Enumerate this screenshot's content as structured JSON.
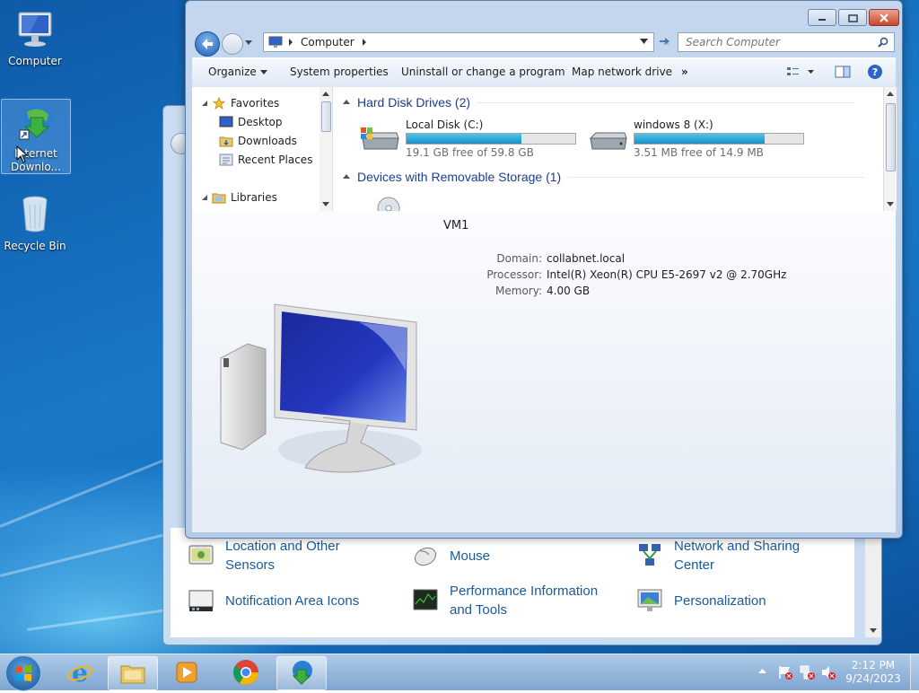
{
  "desktop": {
    "icons": [
      {
        "label": "Computer"
      },
      {
        "label_line1": "Internet",
        "label_line2": "Downlo..."
      },
      {
        "label": "Recycle Bin"
      }
    ]
  },
  "explorer": {
    "address": {
      "segment": "Computer"
    },
    "search": {
      "placeholder": "Search Computer"
    },
    "toolbar": {
      "organize": "Organize",
      "system_properties": "System properties",
      "uninstall": "Uninstall or change a program",
      "map_drive": "Map network drive",
      "more": "»"
    },
    "nav": {
      "favorites": "Favorites",
      "desktop": "Desktop",
      "downloads": "Downloads",
      "recent": "Recent Places",
      "libraries": "Libraries"
    },
    "groups": {
      "hdd": "Hard Disk Drives (2)",
      "removable": "Devices with Removable Storage (1)"
    },
    "drives": [
      {
        "name": "Local Disk (C:)",
        "free": "19.1 GB free of 59.8 GB",
        "used_fraction": 0.68
      },
      {
        "name": "windows 8 (X:)",
        "free": "3.51 MB free of 14.9 MB",
        "used_fraction": 0.77
      }
    ],
    "details": {
      "computer_name": "VM1",
      "domain_label": "Domain:",
      "domain": "collabnet.local",
      "processor_label": "Processor:",
      "processor": "Intel(R) Xeon(R) CPU E5-2697 v2 @ 2.70GHz",
      "memory_label": "Memory:",
      "memory": "4.00 GB"
    }
  },
  "control_panel": {
    "items": [
      {
        "label_line1": "Location and Other",
        "label_line2": "Sensors"
      },
      {
        "label": "Mouse"
      },
      {
        "label_line1": "Network and Sharing",
        "label_line2": "Center"
      },
      {
        "label": "Notification Area Icons"
      },
      {
        "label_line1": "Performance Information",
        "label_line2": "and Tools"
      },
      {
        "label": "Personalization"
      }
    ]
  },
  "taskbar": {
    "clock": {
      "time": "2:12 PM",
      "date": "9/24/2023"
    }
  }
}
